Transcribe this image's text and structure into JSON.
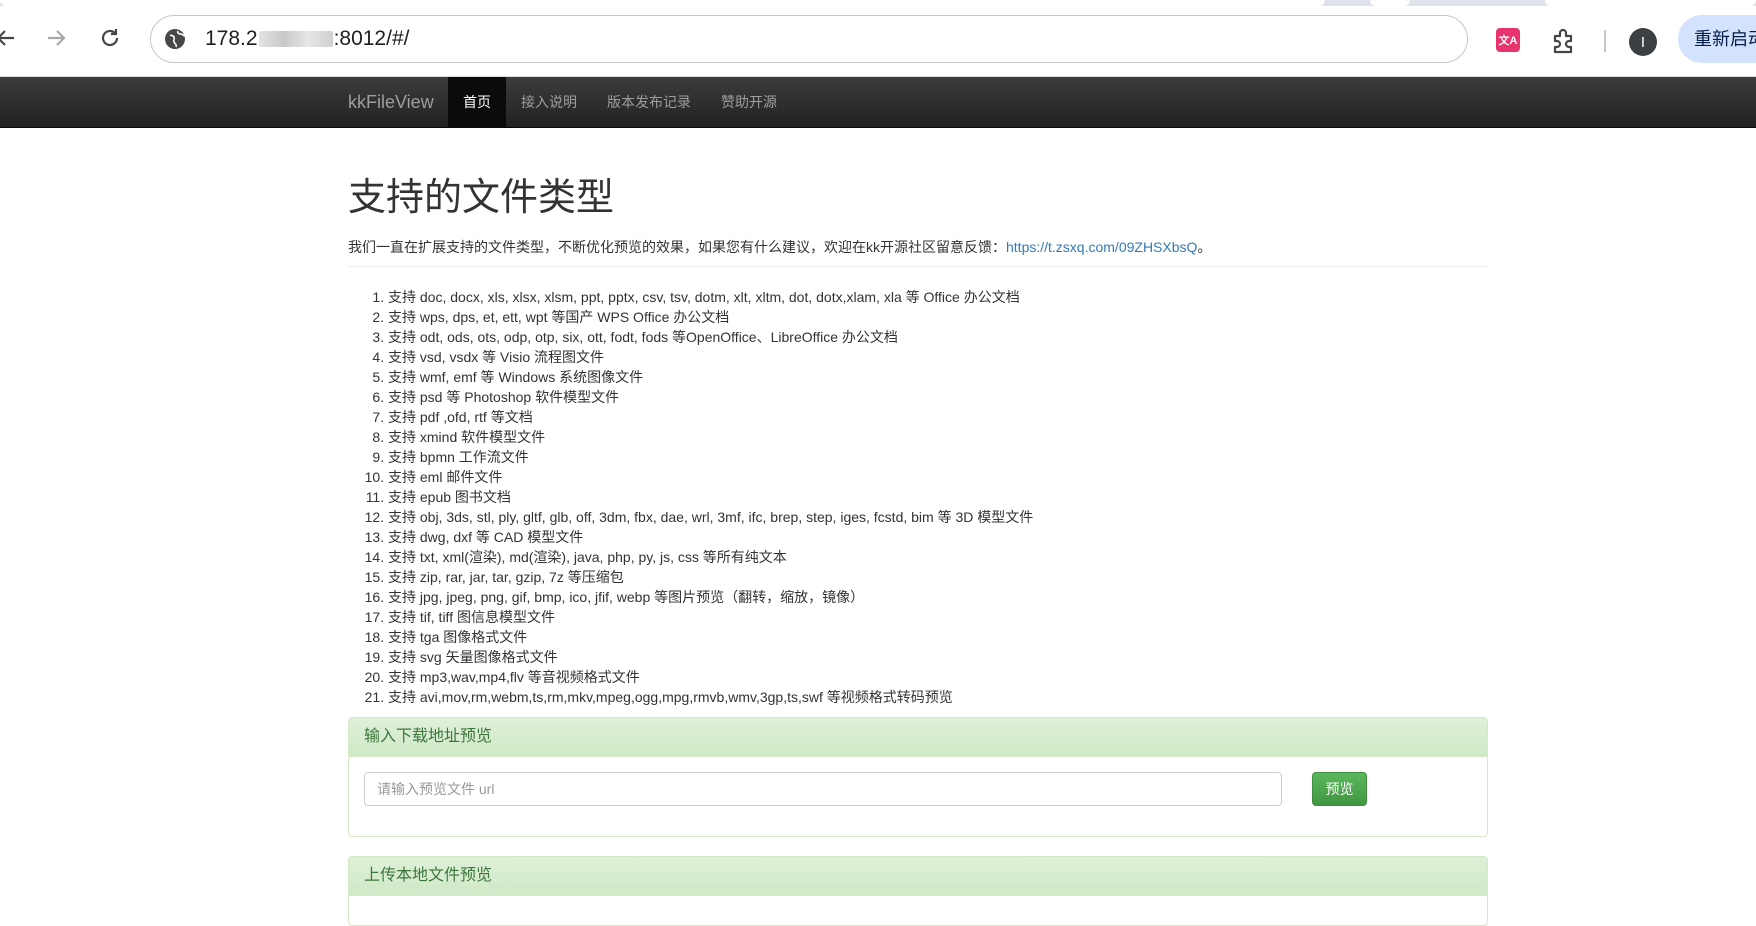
{
  "browser": {
    "url_prefix": "178.2",
    "url_suffix": ":8012/#/",
    "translate_ext_label": "文A",
    "avatar_letter": "I",
    "relaunch_label": "重新启动",
    "icons": [
      "back-arrow-icon",
      "forward-arrow-icon",
      "reload-icon",
      "site-info-icon",
      "translate-icon",
      "puzzle-icon",
      "avatar-icon"
    ]
  },
  "navbar": {
    "brand": "kkFileView",
    "items": [
      {
        "label": "首页",
        "active": true
      },
      {
        "label": "接入说明",
        "active": false
      },
      {
        "label": "版本发布记录",
        "active": false
      },
      {
        "label": "赞助开源",
        "active": false
      }
    ]
  },
  "content": {
    "title": "支持的文件类型",
    "intro_text": "我们一直在扩展支持的文件类型，不断优化预览的效果，如果您有什么建议，欢迎在kk开源社区留意反馈：",
    "intro_link": "https://t.zsxq.com/09ZHSXbsQ",
    "intro_end": "。",
    "file_types": [
      "支持 doc, docx, xls, xlsx, xlsm, ppt, pptx, csv, tsv, dotm, xlt, xltm, dot, dotx,xlam, xla 等 Office 办公文档",
      "支持 wps, dps, et, ett, wpt 等国产 WPS Office 办公文档",
      "支持 odt, ods, ots, odp, otp, six, ott, fodt, fods 等OpenOffice、LibreOffice 办公文档",
      "支持 vsd, vsdx 等 Visio 流程图文件",
      "支持 wmf, emf 等 Windows 系统图像文件",
      "支持 psd 等 Photoshop 软件模型文件",
      "支持 pdf ,ofd, rtf 等文档",
      "支持 xmind 软件模型文件",
      "支持 bpmn 工作流文件",
      "支持 eml 邮件文件",
      "支持 epub 图书文档",
      "支持 obj, 3ds, stl, ply, gltf, glb, off, 3dm, fbx, dae, wrl, 3mf, ifc, brep, step, iges, fcstd, bim 等 3D 模型文件",
      "支持 dwg, dxf 等 CAD 模型文件",
      "支持 txt, xml(渲染), md(渲染), java, php, py, js, css 等所有纯文本",
      "支持 zip, rar, jar, tar, gzip, 7z 等压缩包",
      "支持 jpg, jpeg, png, gif, bmp, ico, jfif, webp 等图片预览（翻转，缩放，镜像）",
      "支持 tif, tiff 图信息模型文件",
      "支持 tga 图像格式文件",
      "支持 svg 矢量图像格式文件",
      "支持 mp3,wav,mp4,flv 等音视频格式文件",
      "支持 avi,mov,rm,webm,ts,rm,mkv,mpeg,ogg,mpg,rmvb,wmv,3gp,ts,swf 等视频格式转码预览"
    ]
  },
  "panels": {
    "url_preview": {
      "heading": "输入下载地址预览",
      "input_placeholder": "请输入预览文件 url",
      "input_value": "",
      "button_label": "预览"
    },
    "upload_preview": {
      "heading": "上传本地文件预览"
    }
  },
  "colors": {
    "navbar": "#222222",
    "link": "#337ab7",
    "panel_heading_bg": "#dff0d8",
    "panel_heading_text": "#3c763d",
    "preview_button": "#5cb85c"
  }
}
